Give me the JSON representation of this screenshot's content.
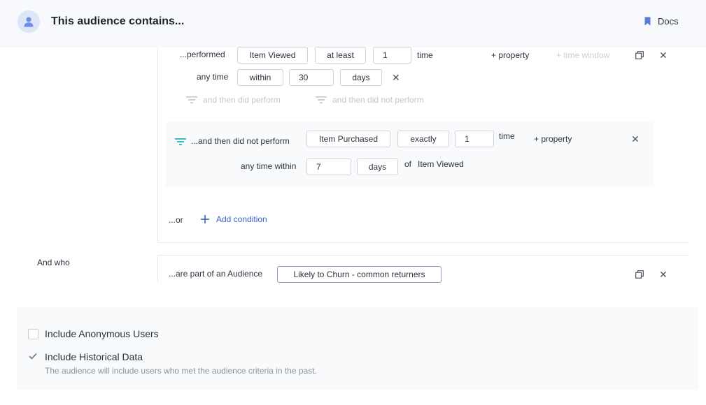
{
  "header": {
    "title": "This audience contains...",
    "docs_label": "Docs",
    "accent": "#5b7bdc"
  },
  "condition": {
    "performed_label": "...performed",
    "event": "Item Viewed",
    "operator": "at least",
    "count": "1",
    "count_unit": "time",
    "add_property": "+ property",
    "time_window": "+ time window",
    "time_label": "any time",
    "time_operator": "within",
    "time_value": "30",
    "time_unit": "days",
    "then_did_perform": "and then did perform",
    "then_did_not_perform": "and then did not perform"
  },
  "nested_condition": {
    "label": "...and then did not perform",
    "event": "Item Purchased",
    "operator": "exactly",
    "count": "1",
    "count_unit": "time",
    "add_property": "+ property",
    "time_label": "any time within",
    "time_value": "7",
    "time_unit": "days",
    "of_label": "of",
    "of_event": "Item Viewed"
  },
  "or_label": "...or",
  "add_condition_label": "Add condition",
  "and_who_label": "And who",
  "audience_condition": {
    "label": "...are part of an Audience",
    "value": "Likely to Churn - common returners"
  },
  "options": {
    "anonymous_label": "Include Anonymous Users",
    "historical_label": "Include Historical Data",
    "historical_hint": "The audience will include users who met the audience criteria in the past."
  }
}
